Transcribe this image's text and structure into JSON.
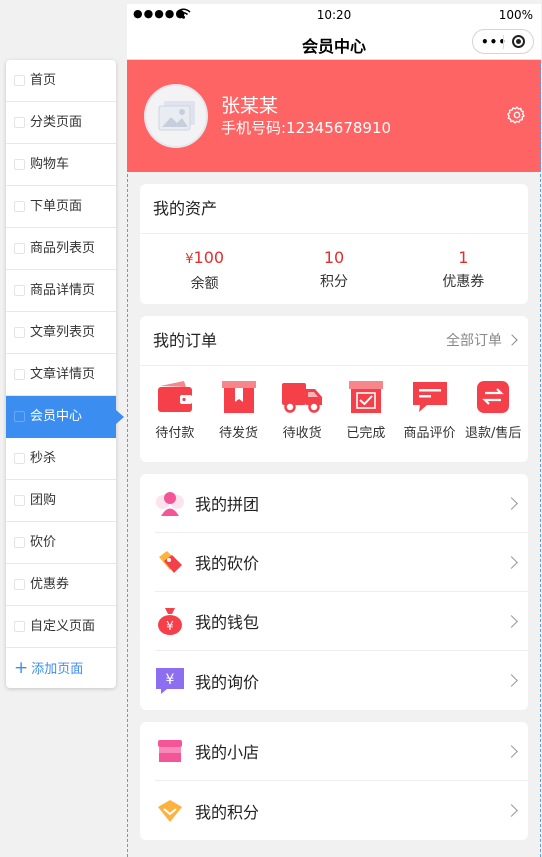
{
  "page_menu": {
    "items": [
      {
        "label": "首页"
      },
      {
        "label": "分类页面"
      },
      {
        "label": "购物车"
      },
      {
        "label": "下单页面"
      },
      {
        "label": "商品列表页"
      },
      {
        "label": "商品详情页"
      },
      {
        "label": "文章列表页"
      },
      {
        "label": "文章详情页"
      },
      {
        "label": "会员中心",
        "active": true
      },
      {
        "label": "秒杀"
      },
      {
        "label": "团购"
      },
      {
        "label": "砍价"
      },
      {
        "label": "优惠券"
      },
      {
        "label": "自定义页面"
      }
    ],
    "add_label": "添加页面"
  },
  "status_bar": {
    "signal": "●●●●●",
    "time": "10:20",
    "battery": "100%"
  },
  "navbar": {
    "title": "会员中心"
  },
  "profile": {
    "name": "张某某",
    "phone": "手机号码:12345678910"
  },
  "assets": {
    "title": "我的资产",
    "items": [
      {
        "value": "100",
        "prefix": "¥",
        "label": "余额"
      },
      {
        "value": "10",
        "label": "积分"
      },
      {
        "value": "1",
        "label": "优惠券"
      }
    ]
  },
  "orders": {
    "title": "我的订单",
    "more": "全部订单",
    "items": [
      {
        "label": "待付款",
        "icon": "wallet-icon"
      },
      {
        "label": "待发货",
        "icon": "box-icon"
      },
      {
        "label": "待收货",
        "icon": "truck-icon"
      },
      {
        "label": "已完成",
        "icon": "check-box-icon"
      },
      {
        "label": "商品评价",
        "icon": "comment-icon"
      },
      {
        "label": "退款/售后",
        "icon": "exchange-icon"
      }
    ]
  },
  "menu_group_1": [
    {
      "label": "我的拼团",
      "icon": "group-icon"
    },
    {
      "label": "我的砍价",
      "icon": "price-tag-icon"
    },
    {
      "label": "我的钱包",
      "icon": "money-bag-icon"
    },
    {
      "label": "我的询价",
      "icon": "inquiry-icon"
    }
  ],
  "menu_group_2": [
    {
      "label": "我的小店",
      "icon": "shop-icon"
    },
    {
      "label": "我的积分",
      "icon": "points-icon"
    }
  ],
  "colors": {
    "header_bg": "#ff6464",
    "accent_red": "#e62d2d",
    "active_menu": "#3c8df0",
    "icon_red": "#f5404a"
  }
}
